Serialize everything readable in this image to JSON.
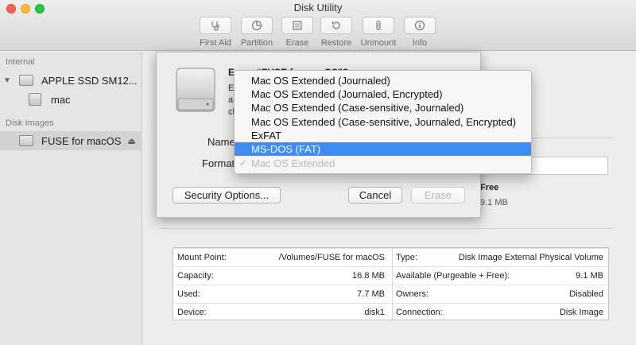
{
  "window": {
    "title": "Disk Utility"
  },
  "toolbar": [
    {
      "label": "First Aid",
      "icon": "stethoscope-icon"
    },
    {
      "label": "Partition",
      "icon": "partition-icon"
    },
    {
      "label": "Erase",
      "icon": "erase-icon"
    },
    {
      "label": "Restore",
      "icon": "restore-icon"
    },
    {
      "label": "Unmount",
      "icon": "unmount-icon"
    },
    {
      "label": "Info",
      "icon": "info-icon"
    }
  ],
  "sidebar": {
    "internal_header": "Internal",
    "disk_images_header": "Disk Images",
    "items": [
      {
        "label": "APPLE SSD SM12..."
      },
      {
        "label": "mac"
      },
      {
        "label": "FUSE for macOS"
      }
    ]
  },
  "sheet": {
    "title": "Erase “FUSE for macOS”?",
    "desc_fragments": [
      "Er",
      "ar",
      "cl"
    ],
    "name_label": "Name",
    "format_label": "Format",
    "security_button": "Security Options...",
    "cancel_button": "Cancel",
    "erase_button": "Erase"
  },
  "format_menu": {
    "options": [
      "Mac OS Extended (Journaled)",
      "Mac OS Extended (Journaled, Encrypted)",
      "Mac OS Extended (Case-sensitive, Journaled)",
      "Mac OS Extended (Case-sensitive, Journaled, Encrypted)",
      "ExFAT",
      "MS-DOS (FAT)",
      "Mac OS Extended"
    ],
    "highlighted": "MS-DOS (FAT)",
    "checked": "Mac OS Extended",
    "check_mark": "✓"
  },
  "background_panel": {
    "free_label": "Free",
    "free_value": "9.1 MB"
  },
  "info": [
    {
      "left_label": "Mount Point:",
      "left_value": "/Volumes/FUSE for macOS",
      "right_label": "Type:",
      "right_value": "Disk Image External Physical Volume"
    },
    {
      "left_label": "Capacity:",
      "left_value": "16.8 MB",
      "right_label": "Available (Purgeable + Free):",
      "right_value": "9.1 MB"
    },
    {
      "left_label": "Used:",
      "left_value": "7.7 MB",
      "right_label": "Owners:",
      "right_value": "Disabled"
    },
    {
      "left_label": "Device:",
      "left_value": "disk1",
      "right_label": "Connection:",
      "right_value": "Disk Image"
    }
  ],
  "colors": {
    "menu_highlight": "#3f8cf4"
  }
}
